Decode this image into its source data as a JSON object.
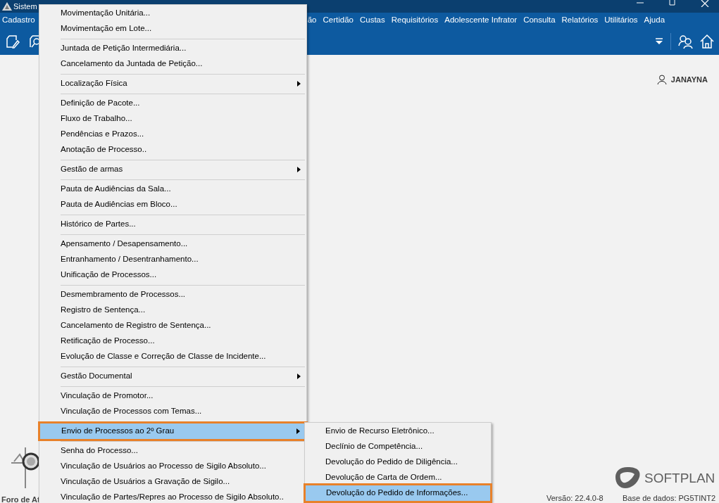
{
  "window": {
    "title": "Sistem"
  },
  "menu_bar": [
    "Cadastro",
    "ão",
    "Certidão",
    "Custas",
    "Requisitórios",
    "Adolescente Infrator",
    "Consulta",
    "Relatórios",
    "Utilitários",
    "Ajuda"
  ],
  "user": {
    "name": "JANAYNA"
  },
  "menu": {
    "items": [
      {
        "kind": "item",
        "label": "Movimentação Unitária...",
        "has_submenu": false,
        "selected": false
      },
      {
        "kind": "item",
        "label": "Movimentação em Lote...",
        "has_submenu": false,
        "selected": false
      },
      {
        "kind": "separator"
      },
      {
        "kind": "item",
        "label": "Juntada de Petição Intermediária...",
        "has_submenu": false,
        "selected": false
      },
      {
        "kind": "item",
        "label": "Cancelamento da Juntada de Petição...",
        "has_submenu": false,
        "selected": false
      },
      {
        "kind": "separator"
      },
      {
        "kind": "item",
        "label": "Localização Física",
        "has_submenu": true,
        "selected": false
      },
      {
        "kind": "separator"
      },
      {
        "kind": "item",
        "label": "Definição de Pacote...",
        "has_submenu": false,
        "selected": false
      },
      {
        "kind": "item",
        "label": "Fluxo de Trabalho...",
        "has_submenu": false,
        "selected": false
      },
      {
        "kind": "item",
        "label": "Pendências e Prazos...",
        "has_submenu": false,
        "selected": false
      },
      {
        "kind": "item",
        "label": "Anotação de Processo..",
        "has_submenu": false,
        "selected": false
      },
      {
        "kind": "separator"
      },
      {
        "kind": "item",
        "label": "Gestão de armas",
        "has_submenu": true,
        "selected": false
      },
      {
        "kind": "separator"
      },
      {
        "kind": "item",
        "label": "Pauta de Audiências da Sala...",
        "has_submenu": false,
        "selected": false
      },
      {
        "kind": "item",
        "label": "Pauta de Audiências em Bloco...",
        "has_submenu": false,
        "selected": false
      },
      {
        "kind": "separator"
      },
      {
        "kind": "item",
        "label": "Histórico de Partes...",
        "has_submenu": false,
        "selected": false
      },
      {
        "kind": "separator"
      },
      {
        "kind": "item",
        "label": "Apensamento / Desapensamento...",
        "has_submenu": false,
        "selected": false
      },
      {
        "kind": "item",
        "label": "Entranhamento / Desentranhamento...",
        "has_submenu": false,
        "selected": false
      },
      {
        "kind": "item",
        "label": "Unificação de Processos...",
        "has_submenu": false,
        "selected": false
      },
      {
        "kind": "separator"
      },
      {
        "kind": "item",
        "label": "Desmembramento de Processos...",
        "has_submenu": false,
        "selected": false
      },
      {
        "kind": "item",
        "label": "Registro de Sentença...",
        "has_submenu": false,
        "selected": false
      },
      {
        "kind": "item",
        "label": "Cancelamento de Registro de Sentença...",
        "has_submenu": false,
        "selected": false
      },
      {
        "kind": "item",
        "label": "Retificação de Processo...",
        "has_submenu": false,
        "selected": false
      },
      {
        "kind": "item",
        "label": "Evolução de Classe e Correção de Classe de Incidente...",
        "has_submenu": false,
        "selected": false
      },
      {
        "kind": "separator"
      },
      {
        "kind": "item",
        "label": "Gestão Documental",
        "has_submenu": true,
        "selected": false
      },
      {
        "kind": "separator"
      },
      {
        "kind": "item",
        "label": "Vinculação de Promotor...",
        "has_submenu": false,
        "selected": false
      },
      {
        "kind": "item",
        "label": "Vinculação de Processos com Temas...",
        "has_submenu": false,
        "selected": false
      },
      {
        "kind": "separator"
      },
      {
        "kind": "item",
        "label": "Envio de Processos ao 2º Grau",
        "has_submenu": true,
        "selected": true
      },
      {
        "kind": "separator"
      },
      {
        "kind": "item",
        "label": "Senha do Processo...",
        "has_submenu": false,
        "selected": false
      },
      {
        "kind": "item",
        "label": "Vinculação de Usuários ao Processo de Sigilo Absoluto...",
        "has_submenu": false,
        "selected": false
      },
      {
        "kind": "item",
        "label": "Vinculação de Usuários a Gravação de Sigilo...",
        "has_submenu": false,
        "selected": false
      },
      {
        "kind": "item",
        "label": "Vinculação de Partes/Repres ao Processo de Sigilo Absoluto..",
        "has_submenu": false,
        "selected": false
      }
    ]
  },
  "submenu": {
    "items": [
      {
        "label": "Envio de Recurso Eletrônico...",
        "selected": false
      },
      {
        "label": "Declínio de Competência...",
        "selected": false
      },
      {
        "label": "Devolução do Pedido de Diligência...",
        "selected": false
      },
      {
        "label": "Devolução de Carta de Ordem...",
        "selected": false
      },
      {
        "label": "Devolução do Pedido de Informações...",
        "selected": true
      }
    ]
  },
  "footer": {
    "court": "Foro de At",
    "brand": "SOFTPLAN",
    "version": "Versão: 22.4.0-8",
    "database": "Base de dados: PG5TINT2"
  }
}
